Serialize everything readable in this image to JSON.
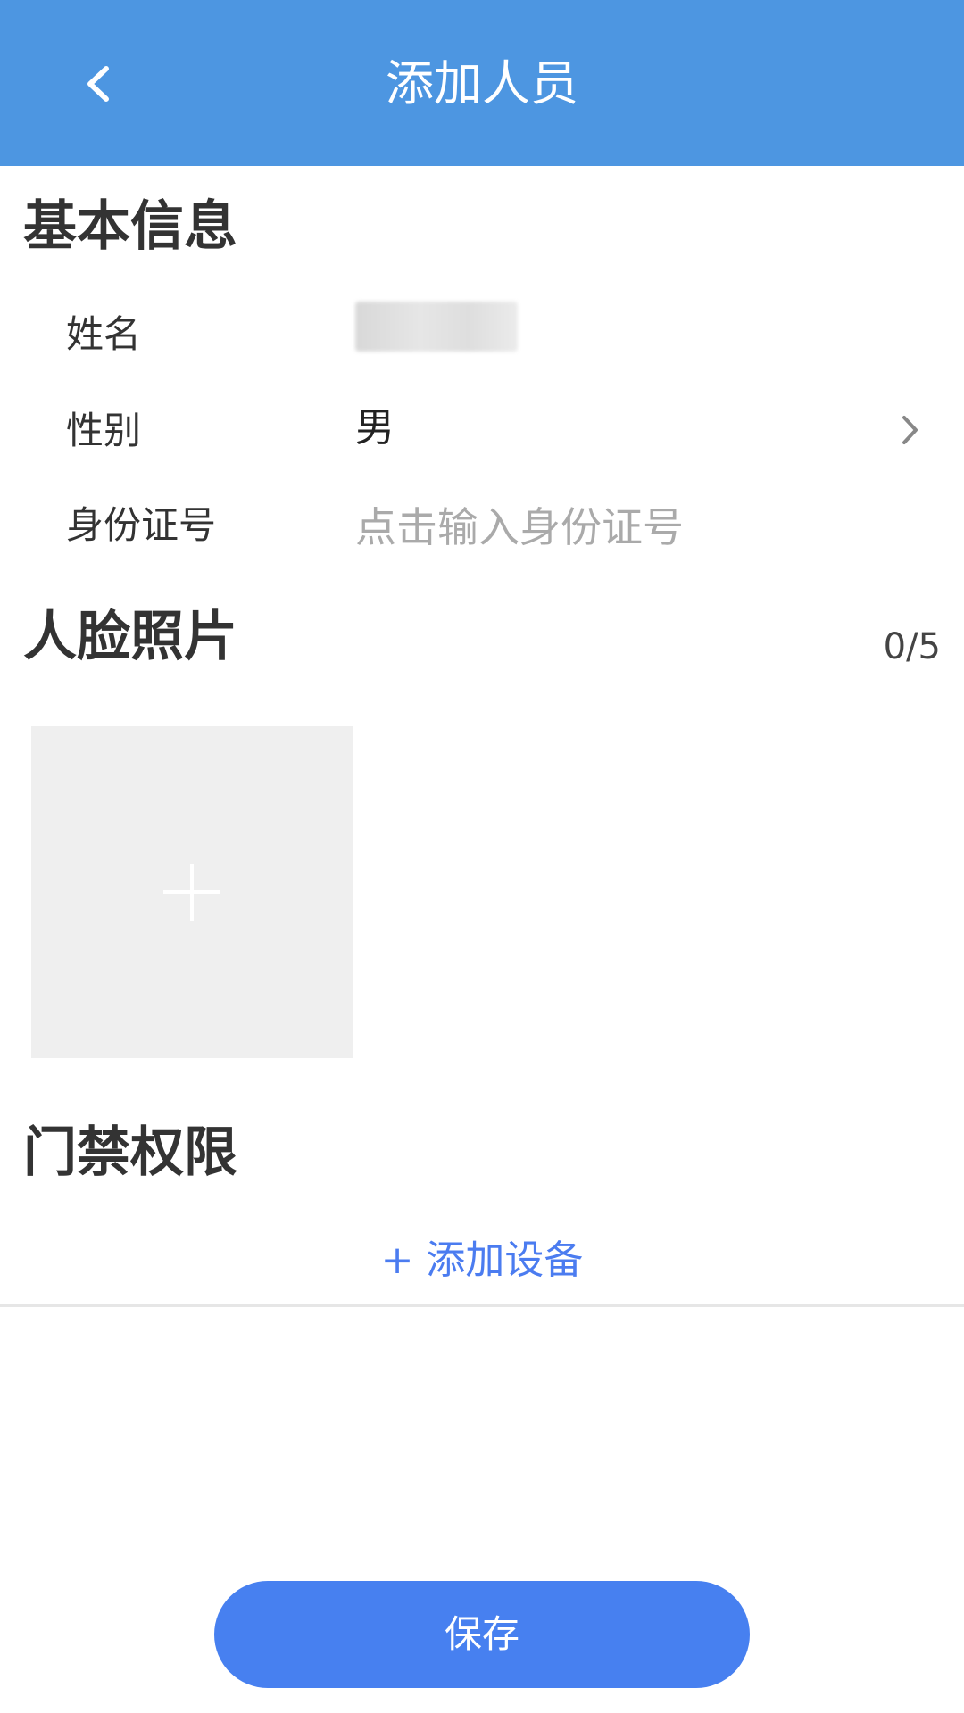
{
  "header": {
    "title": "添加人员",
    "back_icon": "chevron-left-icon"
  },
  "basic_info": {
    "title": "基本信息",
    "name_label": "姓名",
    "gender_label": "性别",
    "gender_value": "男",
    "id_label": "身份证号",
    "id_placeholder": "点击输入身份证号"
  },
  "face_photos": {
    "title": "人脸照片",
    "count": "0/5",
    "add_icon": "plus-icon"
  },
  "access": {
    "title": "门禁权限",
    "add_device_label": "+ 添加设备"
  },
  "footer": {
    "save_label": "保存"
  },
  "colors": {
    "primary": "#4d96e1",
    "button": "#4780f0",
    "link": "#4b7cf0"
  }
}
